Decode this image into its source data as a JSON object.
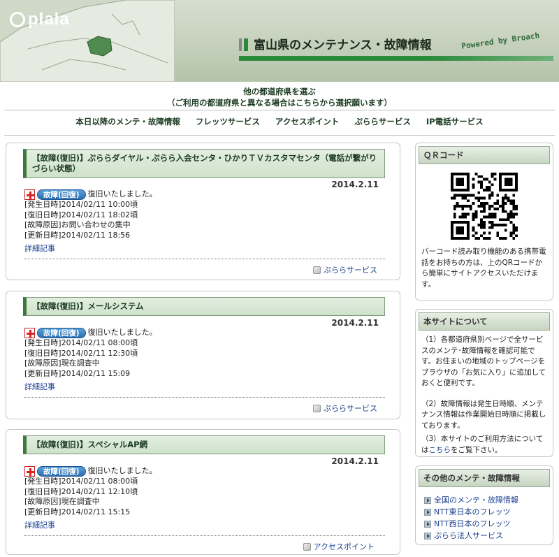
{
  "header": {
    "logo": "plala",
    "title": "富山県のメンテナンス・故障情報",
    "powered": "Powered by Broach"
  },
  "pref": {
    "line1": "他の都道府県を選ぶ",
    "line2": "（ご利用の都道府県と異なる場合はこちらから選択願います）"
  },
  "nav": {
    "items": [
      "本日以降のメンテ・故障情報",
      "フレッツサービス",
      "アクセスポイント",
      "ぷららサービス",
      "IP電話サービス"
    ]
  },
  "cards": [
    {
      "title": "【故障(復旧)】ぷららダイヤル・ぷらら入会センタ・ひかりＴＶカスタマセンタ（電話が繋がりづらい状態）",
      "date": "2014.2.11",
      "badge": "故障(回復)",
      "status": "復旧いたしました。",
      "lines": [
        "[発生日時]2014/02/11 10:00頃",
        "[復旧日時]2014/02/11 18:02頃",
        "[故障原因]お問い合わせの集中",
        "[更新日時]2014/02/11 18:56"
      ],
      "detail": "詳細記事",
      "service": "ぷららサービス"
    },
    {
      "title": "【故障(復旧)】メールシステム",
      "date": "2014.2.11",
      "badge": "故障(回復)",
      "status": "復旧いたしました。",
      "lines": [
        "[発生日時]2014/02/11 08:00頃",
        "[復旧日時]2014/02/11 12:30頃",
        "[故障原因]現在調査中",
        "[更新日時]2014/02/11 15:09"
      ],
      "detail": "詳細記事",
      "service": "ぷららサービス"
    },
    {
      "title": "【故障(復旧)】スペシャルAP網",
      "date": "2014.2.11",
      "badge": "故障(回復)",
      "status": "復旧いたしました。",
      "lines": [
        "[発生日時]2014/02/11 08:00頃",
        "[復旧日時]2014/02/11 12:10頃",
        "[故障原因]現在調査中",
        "[更新日時]2014/02/11 15:15"
      ],
      "detail": "詳細記事",
      "service": "アクセスポイント"
    }
  ],
  "sidebar": {
    "qr": {
      "title": "ＱＲコード",
      "text": "バーコード読み取り機能のある携帯電話をお持ちの方は、上のQRコードから簡単にサイトアクセスいただけます。"
    },
    "about": {
      "title": "本サイトについて",
      "p1": "（1）各都道府県別ページで全サービスのメンテ･故障情報を確認可能です。お住まいの地域のトップページをブラウザの「お気に入り」に追加しておくと便利です。",
      "p2": "（2）故障情報は発生日時順、メンテナンス情報は作業開始日時順に掲載しております。",
      "p3a": "（3）本サイトのご利用方法については",
      "p3link": "こちら",
      "p3b": "をご覧下さい。"
    },
    "other": {
      "title": "その他のメンテ・故障情報",
      "links": [
        "全国のメンテ・故障情報",
        "NTT東日本のフレッツ",
        "NTT西日本のフレッツ",
        "ぷらら法人サービス"
      ]
    }
  }
}
